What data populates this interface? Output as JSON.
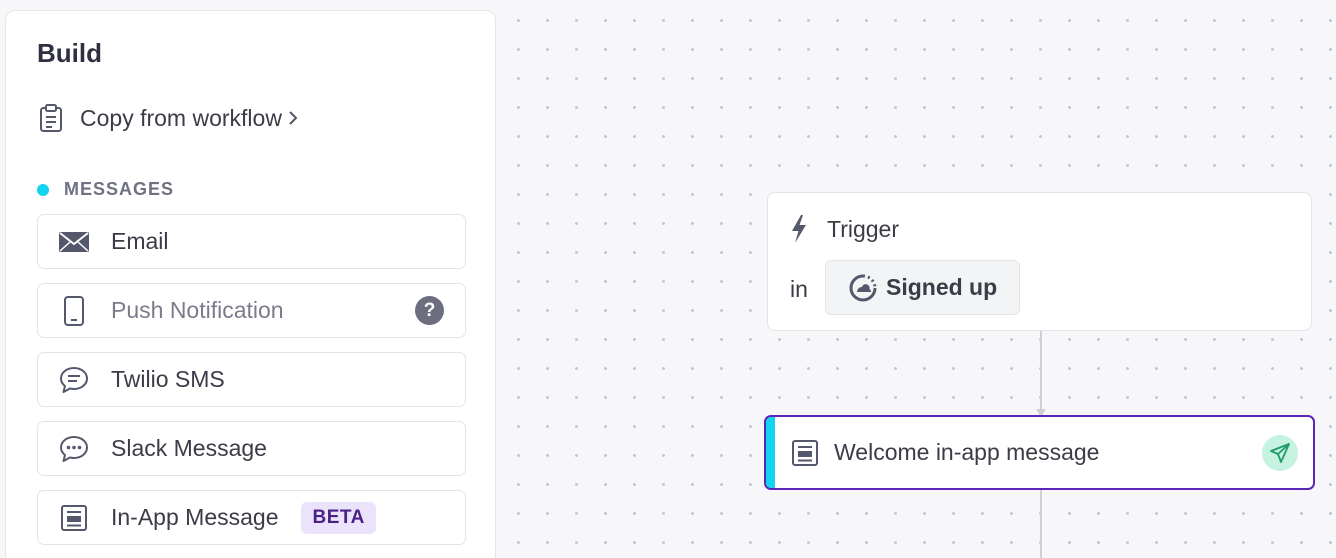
{
  "sidebar": {
    "title": "Build",
    "copy_link": {
      "label": "Copy from workflow",
      "icon": "clipboard-icon"
    },
    "section": {
      "label": "MESSAGES",
      "dot_color": "#13d3ee"
    },
    "items": [
      {
        "label": "Email",
        "icon": "envelope-icon"
      },
      {
        "label": "Push Notification",
        "icon": "mobile-phone-icon",
        "help": "?"
      },
      {
        "label": "Twilio SMS",
        "icon": "chat-bubble-icon"
      },
      {
        "label": "Slack Message",
        "icon": "chat-dots-icon"
      },
      {
        "label": "In-App Message",
        "icon": "in-app-icon",
        "badge": "BETA"
      }
    ]
  },
  "canvas": {
    "trigger": {
      "label": "Trigger",
      "icon": "lightning-bolt-icon",
      "in_label": "in",
      "event": {
        "label": "Signed up",
        "icon": "segment-icon"
      }
    },
    "message_node": {
      "label": "Welcome in-app message",
      "icon": "in-app-icon",
      "status_icon": "send-icon",
      "accent_color": "#13d3ee",
      "border_color": "#5b26b8"
    }
  }
}
